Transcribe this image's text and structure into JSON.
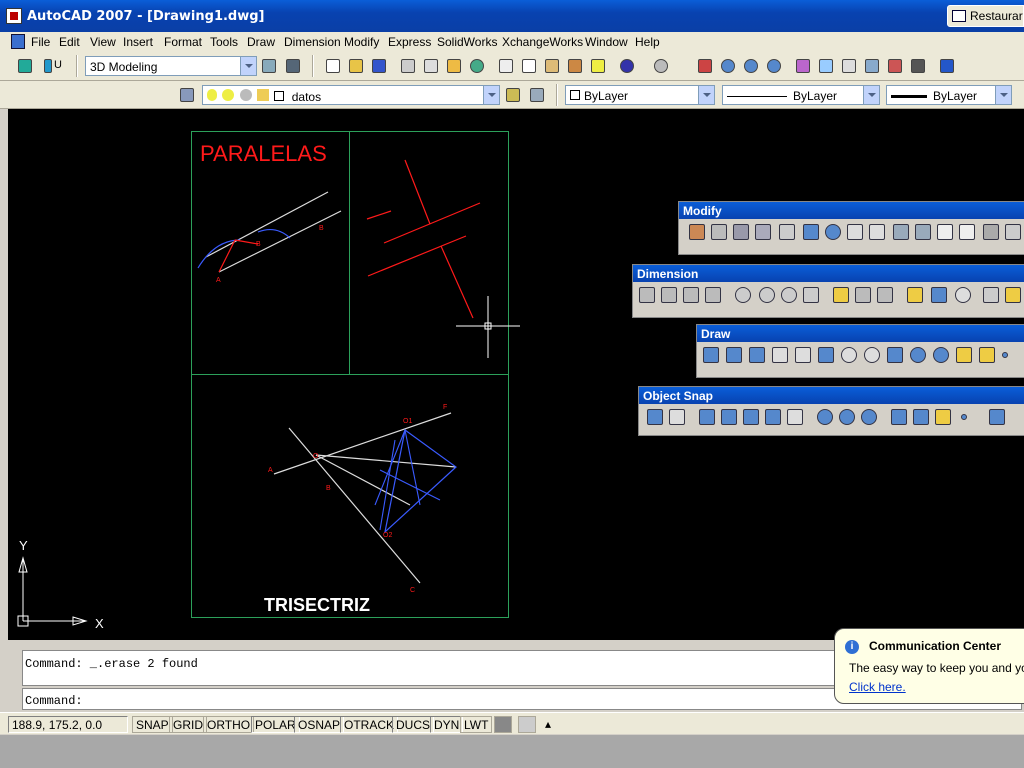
{
  "window": {
    "title": "AutoCAD 2007 - [Drawing1.dwg]",
    "restore_label": "Restaurar"
  },
  "menu": [
    "File",
    "Edit",
    "View",
    "Insert",
    "Format",
    "Tools",
    "Draw",
    "Dimension",
    "Modify",
    "Express",
    "SolidWorks",
    "XchangeWorks",
    "Window",
    "Help"
  ],
  "workspace": {
    "toggle_label": "U",
    "selected": "3D Modeling"
  },
  "layers": {
    "current": "datos"
  },
  "properties": {
    "color": "ByLayer",
    "linetype": "ByLayer",
    "lineweight": "ByLayer"
  },
  "drawing": {
    "title_parallel": "PARALELAS",
    "title_trisect": "TRISECTRIZ",
    "labels": {
      "a1": "A",
      "b1": "B",
      "c1": "B",
      "o": "O",
      "a2": "A",
      "b2": "B",
      "o1": "O1",
      "o2": "O2",
      "f": "F",
      "c2": "C"
    },
    "ucs": {
      "x": "X",
      "y": "Y"
    }
  },
  "palettes": {
    "modify": {
      "title": "Modify"
    },
    "dimension": {
      "title": "Dimension"
    },
    "draw": {
      "title": "Draw"
    },
    "osnap": {
      "title": "Object Snap"
    }
  },
  "command": {
    "history": "Command: _.erase 2 found",
    "prompt": "Command:"
  },
  "comm_center": {
    "title": "Communication Center",
    "body": "The easy way to keep you and your s",
    "link": "Click here."
  },
  "status": {
    "coords": "188.9, 175.2, 0.0",
    "buttons": [
      "SNAP",
      "GRID",
      "ORTHO",
      "POLAR",
      "OSNAP",
      "OTRACK",
      "DUCS",
      "DYN",
      "LWT"
    ],
    "active": [
      "POLAR",
      "OSNAP",
      "OTRACK",
      "DUCS",
      "DYN"
    ]
  },
  "colors": {
    "canvas": "#000000",
    "frame": "#2ca05a",
    "red": "#ff1a1a",
    "blue": "#3a5bff",
    "title_bar": "#0a4fc8"
  }
}
